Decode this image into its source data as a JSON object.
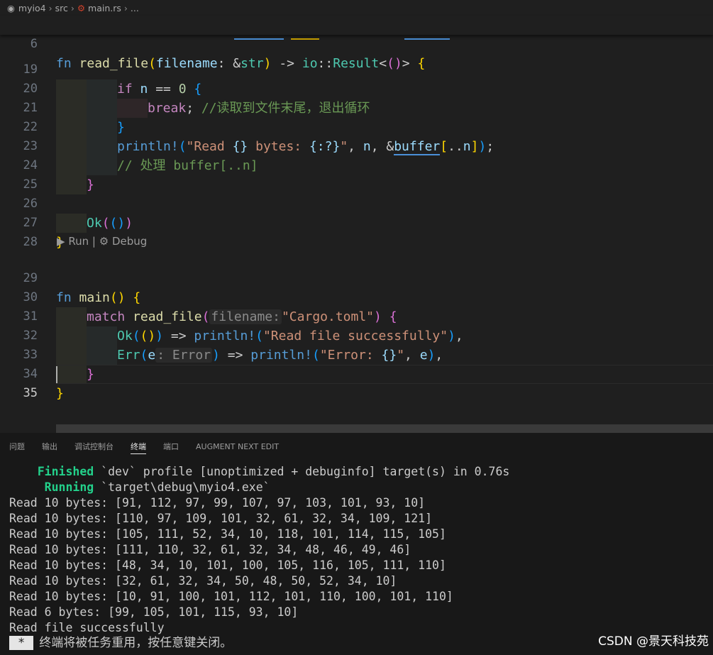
{
  "breadcrumb": {
    "project": "myio4",
    "folder": "src",
    "file": "main.rs",
    "more": "..."
  },
  "editor": {
    "sticky": {
      "line_number": "6",
      "text": "fn read_file(filename: &str) -> io::Result<()> {"
    },
    "lines": [
      {
        "number": "19",
        "text": "if n == 0 {"
      },
      {
        "number": "20",
        "text": "break; //读取到文件末尾，退出循环"
      },
      {
        "number": "21",
        "text": "}"
      },
      {
        "number": "22",
        "text": "println!(\"Read {} bytes: {:?}\", n, &buffer[..n]);"
      },
      {
        "number": "23",
        "text": "// 处理 buffer[..n]"
      },
      {
        "number": "24",
        "text": "}"
      },
      {
        "number": "25",
        "text": ""
      },
      {
        "number": "26",
        "text": "Ok(())"
      },
      {
        "number": "27",
        "text": "}"
      },
      {
        "number": "28",
        "text": ""
      },
      {
        "number": "29",
        "text": "fn main() {"
      },
      {
        "number": "30",
        "text": "match read_file(filename: \"Cargo.toml\") {"
      },
      {
        "number": "31",
        "text": "Ok(()) => println!(\"Read file successfully\"),"
      },
      {
        "number": "32",
        "text": "Err(e: Error) => println!(\"Error: {}\", e),"
      },
      {
        "number": "33",
        "text": "}"
      },
      {
        "number": "34",
        "text": "}"
      },
      {
        "number": "35",
        "text": ""
      }
    ],
    "codelens": {
      "run": "Run",
      "separator": "|",
      "debug": "Debug"
    },
    "hints": {
      "filename": "filename:",
      "error_type": ": Error"
    }
  },
  "panel": {
    "tabs": [
      "问题",
      "输出",
      "调试控制台",
      "终端",
      "端口",
      "AUGMENT NEXT EDIT"
    ],
    "active_tab": "终端",
    "terminal": {
      "finished_label": "Finished",
      "finished_text": "`dev` profile [unoptimized + debuginfo] target(s) in 0.76s",
      "running_label": "Running",
      "running_text": "`target\\debug\\myio4.exe`",
      "output": [
        "Read 10 bytes: [91, 112, 97, 99, 107, 97, 103, 101, 93, 10]",
        "Read 10 bytes: [110, 97, 109, 101, 32, 61, 32, 34, 109, 121]",
        "Read 10 bytes: [105, 111, 52, 34, 10, 118, 101, 114, 115, 105]",
        "Read 10 bytes: [111, 110, 32, 61, 32, 34, 48, 46, 49, 46]",
        "Read 10 bytes: [48, 34, 10, 101, 100, 105, 116, 105, 111, 110]",
        "Read 10 bytes: [32, 61, 32, 34, 50, 48, 50, 52, 34, 10]",
        "Read 10 bytes: [10, 91, 100, 101, 112, 101, 110, 100, 101, 110]",
        "Read 6 bytes: [99, 105, 101, 115, 93, 10]",
        "Read file successfully"
      ],
      "star": "*",
      "closing_message": "终端将被任务重用，按任意键关闭。"
    }
  },
  "watermark": "CSDN @景天科技苑"
}
